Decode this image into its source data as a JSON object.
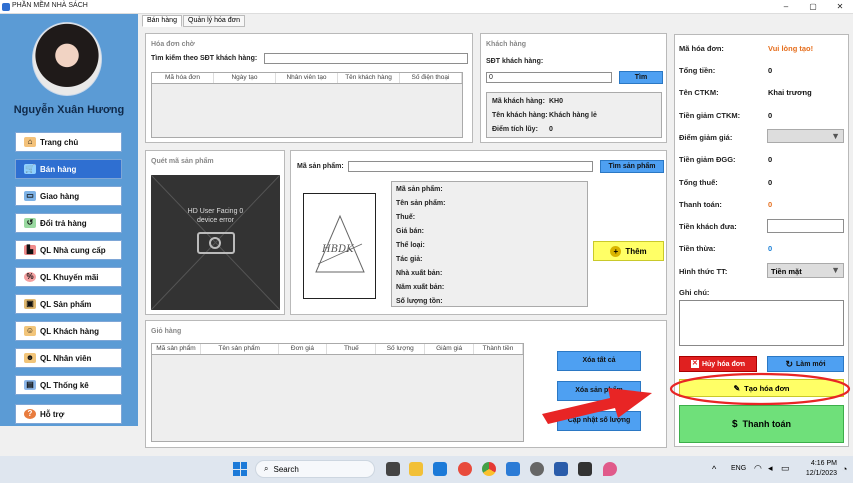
{
  "window": {
    "title": "PHẦN MỀM NHÀ SÁCH",
    "min": "–",
    "max": "▢",
    "close": "✕"
  },
  "sidebar": {
    "username": "Nguyễn Xuân Hương",
    "items": [
      {
        "label": "Trang chủ",
        "icon": "home-icon"
      },
      {
        "label": "Bán hàng",
        "icon": "cart-icon"
      },
      {
        "label": "Giao hàng",
        "icon": "truck-icon"
      },
      {
        "label": "Đổi trả hàng",
        "icon": "return-icon"
      },
      {
        "label": "QL Nhà cung cấp",
        "icon": "factory-icon"
      },
      {
        "label": "QL Khuyến mãi",
        "icon": "sale-icon"
      },
      {
        "label": "QL Sản phẩm",
        "icon": "box-icon"
      },
      {
        "label": "QL Khách hàng",
        "icon": "people-icon"
      },
      {
        "label": "QL Nhân viên",
        "icon": "person-icon"
      },
      {
        "label": "QL Thống kê",
        "icon": "chart-icon"
      },
      {
        "label": "Hỗ trợ",
        "icon": "help-icon"
      }
    ]
  },
  "tabs": [
    "Bán hàng",
    "Quản lý hóa đơn"
  ],
  "pending": {
    "title": "Hóa đơn chờ",
    "search_label": "Tìm kiếm theo SĐT khách hàng:",
    "columns": [
      "Mã hóa đơn",
      "Ngày tạo",
      "Nhân viên tạo",
      "Tên khách hàng",
      "Số điện thoại"
    ]
  },
  "customer": {
    "title": "Khách hàng",
    "phone_label": "SĐT khách hàng:",
    "phone_value": "0",
    "search_btn": "Tìm",
    "code_label": "Mã khách hàng:",
    "code_value": "KH0",
    "name_label": "Tên khách hàng:",
    "name_value": "Khách hàng lẻ",
    "points_label": "Điểm tích lũy:",
    "points_value": "0"
  },
  "scan": {
    "title": "Quét mã sản phẩm",
    "cam_line1": "HD User Facing 0",
    "cam_line2": "device error"
  },
  "product": {
    "code_label": "Mã sản phẩm:",
    "search_btn": "Tìm sản phẩm",
    "add_btn": "Thêm",
    "fields": [
      "Mã sản phẩm:",
      "Tên sản phẩm:",
      "Thuế:",
      "Giá bán:",
      "Thể loại:",
      "Tác giả:",
      "Nhà xuất bản:",
      "Năm xuất bản:",
      "Số lượng tồn:"
    ],
    "logo_text": "HBDK"
  },
  "cart": {
    "title": "Giỏ hàng",
    "columns": [
      "Mã sản phẩm",
      "Tên sản phẩm",
      "Đơn giá",
      "Thuế",
      "Số lượng",
      "Giảm giá",
      "Thành tiền"
    ],
    "clear_btn": "Xóa tất cả",
    "remove_btn": "Xóa sản phẩm",
    "update_btn": "Cập nhật số lượng"
  },
  "invoice": {
    "code_label": "Mã hóa đơn:",
    "code_value": "Vui lòng tạo!",
    "total_label": "Tổng tiền:",
    "total_value": "0",
    "promo_label": "Tên CTKM:",
    "promo_value": "Khai trương",
    "promo_discount_label": "Tiền giảm CTKM:",
    "promo_discount_value": "0",
    "points_label": "Điểm giảm giá:",
    "points_discount_label": "Tiền giảm ĐGG:",
    "points_discount_value": "0",
    "tax_label": "Tổng thuế:",
    "tax_value": "0",
    "pay_label": "Thanh toán:",
    "pay_value": "0",
    "given_label": "Tiền khách đưa:",
    "change_label": "Tiền thừa:",
    "change_value": "0",
    "method_label": "Hình thức TT:",
    "method_value": "Tiền mặt",
    "note_label": "Ghi chú:",
    "cancel_btn": "Hủy hóa đơn",
    "reset_btn": "Làm mới",
    "create_btn": "Tạo hóa đơn",
    "checkout_btn": "Thanh toán",
    "colors": {
      "orange": "#e66f1e",
      "blue": "#1a7fd6",
      "red": "#e02020",
      "green": "#6fe07a",
      "yellow": "#ffff66"
    }
  },
  "taskbar": {
    "search": "Search",
    "lang": "ENG",
    "time": "4:16 PM",
    "date": "12/1/2023"
  }
}
